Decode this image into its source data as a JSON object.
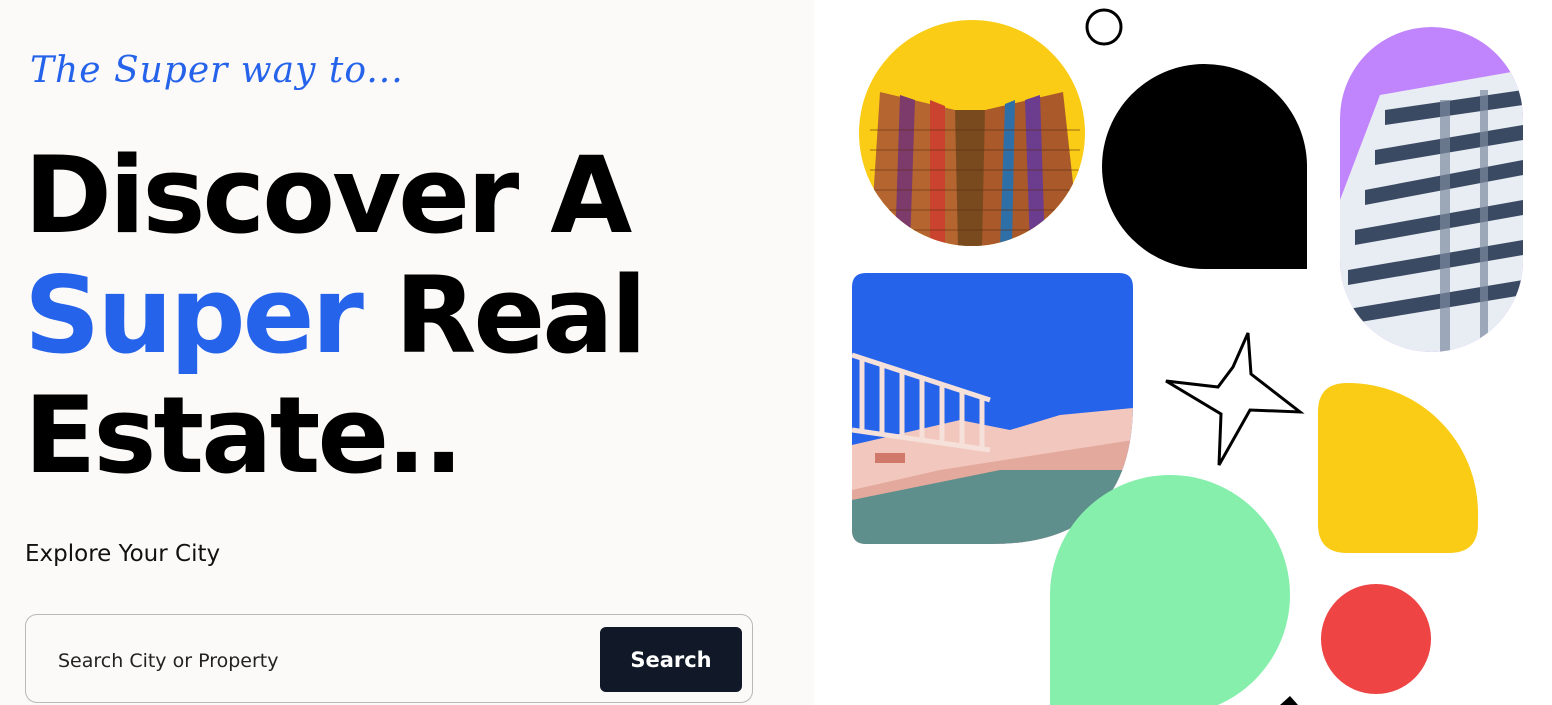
{
  "hero": {
    "tagline": "The Super way to...",
    "headline": {
      "line1": "Discover A",
      "line2_accent": "Super",
      "line2_rest": " Real",
      "line3": "Estate.."
    },
    "subtitle": "Explore Your City",
    "search": {
      "placeholder": "Search City or Property",
      "value": "",
      "button_label": "Search"
    }
  },
  "colors": {
    "accent_blue": "#2563eb",
    "dark": "#111827",
    "yellow": "#facc15",
    "purple": "#c084fc",
    "green": "#86efac",
    "red": "#ef4444"
  },
  "decor": {
    "images": [
      "building-towers-photo",
      "building-balconies-photo",
      "stair-railing-photo"
    ],
    "shapes": [
      "ring-shape",
      "black-teardrop-shape",
      "starburst-shape",
      "yellow-teardrop-shape",
      "green-teardrop-shape",
      "red-circle-shape"
    ]
  }
}
